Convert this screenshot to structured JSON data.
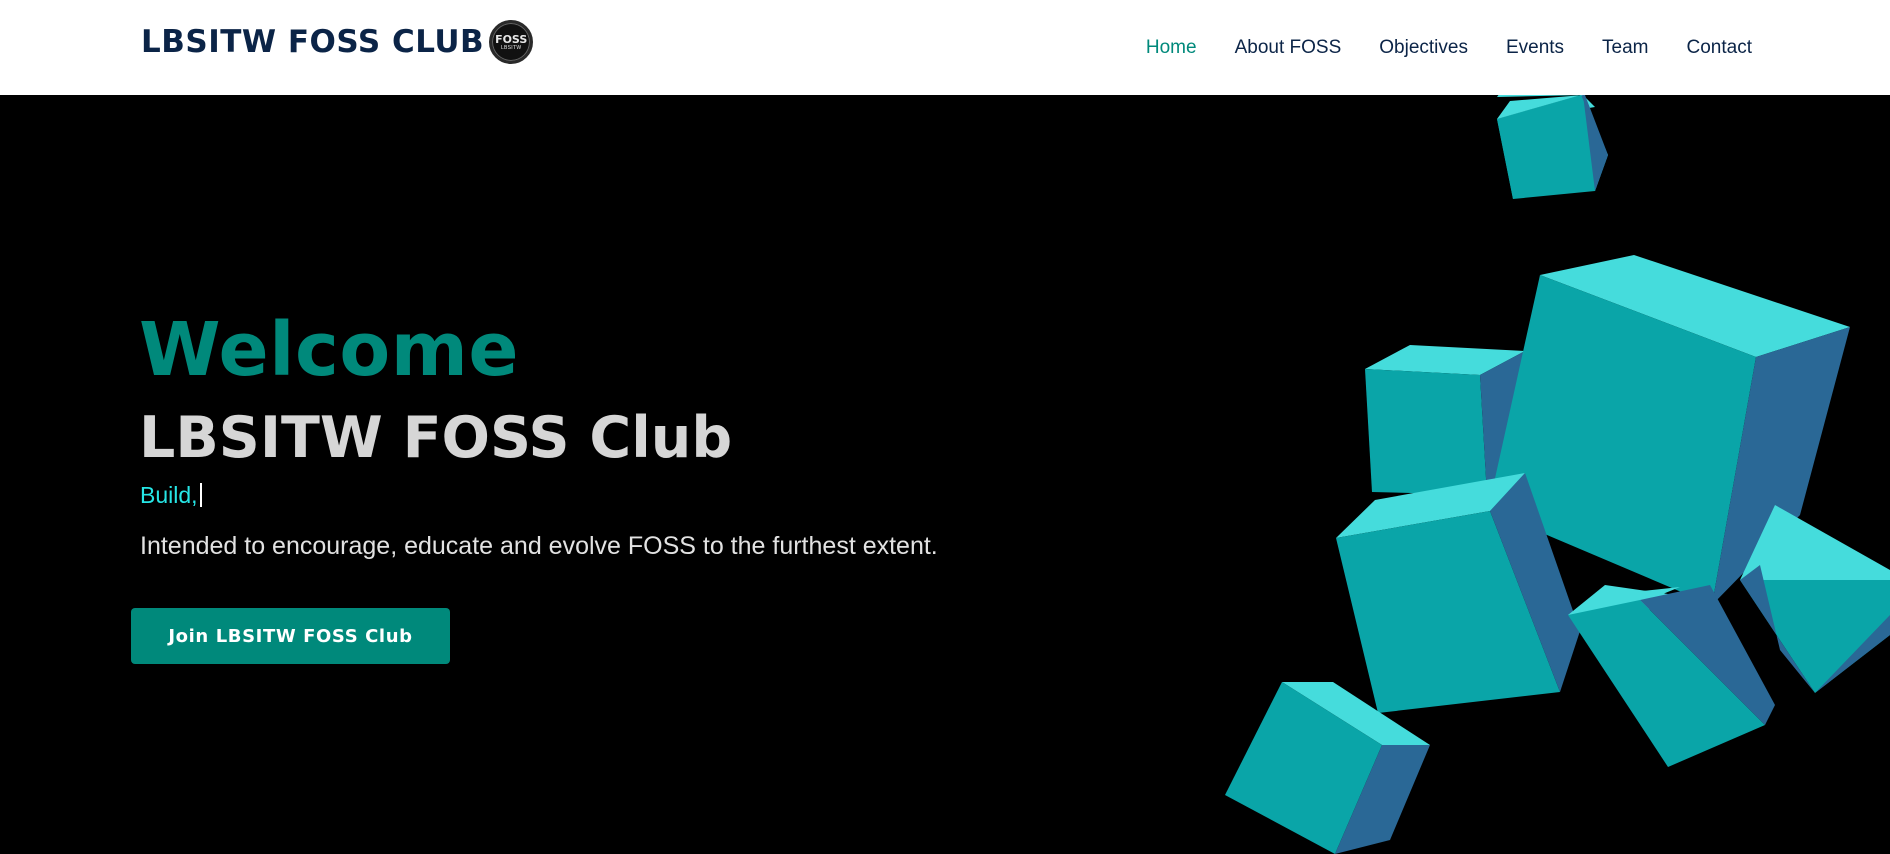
{
  "header": {
    "brand": "LBSITW FOSS CLUB",
    "logo": {
      "line1": "FOSS",
      "line2": "LBSITW"
    },
    "nav": [
      {
        "label": "Home",
        "active": true
      },
      {
        "label": "About FOSS",
        "active": false
      },
      {
        "label": "Objectives",
        "active": false
      },
      {
        "label": "Events",
        "active": false
      },
      {
        "label": "Team",
        "active": false
      },
      {
        "label": "Contact",
        "active": false
      }
    ]
  },
  "hero": {
    "welcome": "Welcome",
    "title": "LBSITW FOSS Club",
    "typing_text": "Build,",
    "tagline": "Intended to encourage, educate and evolve FOSS to the furthest extent.",
    "cta_label": "Join LBSITW FOSS Club"
  },
  "colors": {
    "accent": "#00897b",
    "navy": "#0b2447",
    "cyan": "#26e6e6",
    "cube_front": "#0aa5a8",
    "cube_top": "#45dcdc",
    "cube_side": "#2a6896"
  }
}
